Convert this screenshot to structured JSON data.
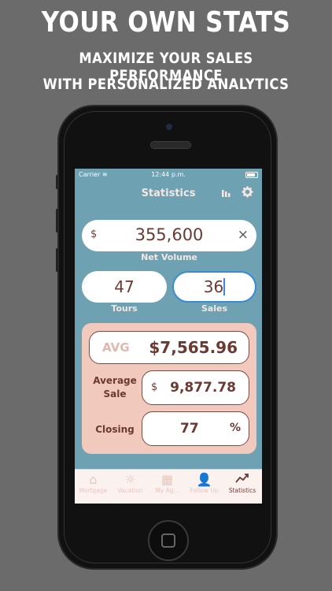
{
  "promo": {
    "headline": "YOUR OWN STATS",
    "sub1": "MAXIMIZE YOUR SALES PERFORMANCE",
    "sub2": "WITH PERSONALIZED ANALYTICS"
  },
  "status_bar": {
    "carrier": "Carrier",
    "time": "12:44 p.m."
  },
  "nav": {
    "title": "Statistics",
    "icons": [
      "bar-chart-icon",
      "gear-icon"
    ]
  },
  "net_volume": {
    "currency": "$",
    "value": "355,600",
    "label": "Net Volume",
    "clear_icon": "×"
  },
  "tours": {
    "value": "47",
    "label": "Tours"
  },
  "sales": {
    "value": "36",
    "label": "Sales"
  },
  "stats_card": {
    "avg_label": "AVG",
    "avg_value": "$7,565.96",
    "average_sale_label_1": "Average",
    "average_sale_label_2": "Sale",
    "average_sale_currency": "$",
    "average_sale_value": "9,877.78",
    "closing_label": "Closing",
    "closing_value": "77",
    "closing_unit": "%"
  },
  "tabs": [
    {
      "label": "Mortgage",
      "icon": "house-icon"
    },
    {
      "label": "Vacation",
      "icon": "sun-icon"
    },
    {
      "label": "My Ag...",
      "icon": "calendar-icon"
    },
    {
      "label": "Follow Up",
      "icon": "add-person-icon"
    },
    {
      "label": "Statistics",
      "icon": "trend-chart-icon",
      "active": true
    }
  ],
  "colors": {
    "background": "#6b6b6b",
    "screen": "#6ea2b3",
    "card": "#f2c9bd",
    "accent_text": "#6a3a32"
  }
}
